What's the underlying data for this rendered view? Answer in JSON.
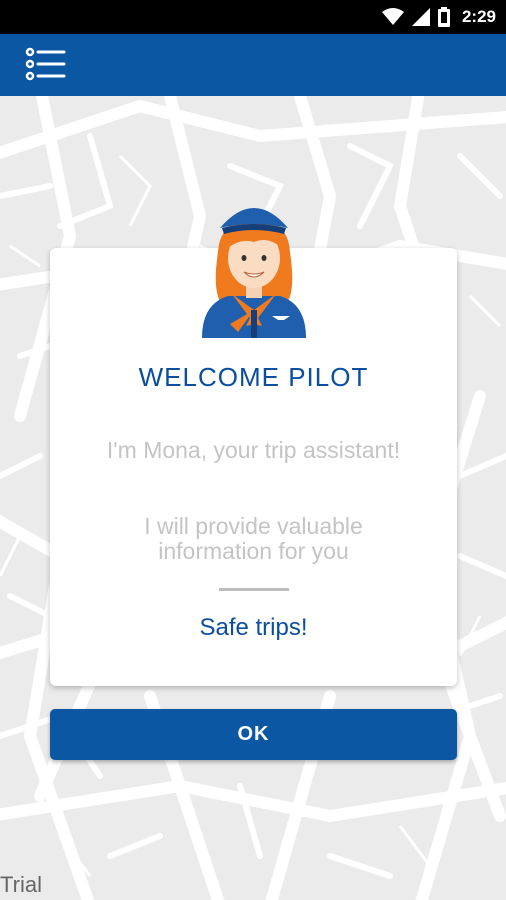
{
  "status_bar": {
    "time": "2:29",
    "icons": [
      "wifi-icon",
      "cellular-signal-icon",
      "battery-icon"
    ]
  },
  "app_bar": {
    "menu_icon": "list-menu-icon",
    "color": "#0b57a4"
  },
  "dialog": {
    "avatar": "flight-attendant-avatar",
    "title": "WELCOME PILOT",
    "message_1": "I'm Mona, your trip assistant!",
    "message_2": "I will provide valuable information for you",
    "closing": "Safe trips!",
    "ok_label": "OK"
  },
  "watermark": "Trial",
  "colors": {
    "primary": "#0b57a4",
    "title_text": "#0b4ea0",
    "muted_text": "#c4c4c4",
    "scarf": "#f07a1e"
  }
}
